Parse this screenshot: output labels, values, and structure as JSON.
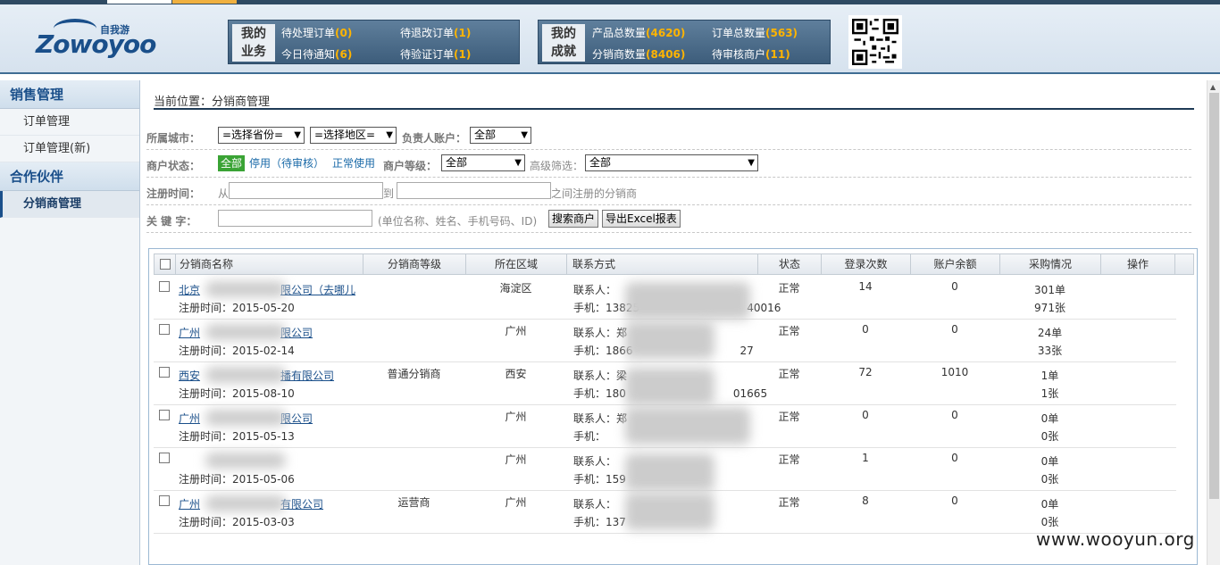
{
  "brand": {
    "logo_cn": "自我游",
    "logo_en": "Zowoyoo"
  },
  "business_panel": {
    "title_line1": "我的",
    "title_line2": "业务",
    "items": [
      {
        "label": "待处理订单",
        "count": "(0)"
      },
      {
        "label": "待退改订单",
        "count": "(1)"
      },
      {
        "label": "今日待通知",
        "count": "(6)"
      },
      {
        "label": "待验证订单",
        "count": "(1)"
      }
    ]
  },
  "achievement_panel": {
    "title_line1": "我的",
    "title_line2": "成就",
    "items": [
      {
        "label": "产品总数量",
        "count": "(4620)"
      },
      {
        "label": "订单总数量",
        "count": "(563)"
      },
      {
        "label": "分销商数量",
        "count": "(8406)"
      },
      {
        "label": "待审核商户",
        "count": "(11)"
      }
    ]
  },
  "sidebar": {
    "groups": [
      {
        "title": "销售管理",
        "items": [
          {
            "label": "订单管理"
          },
          {
            "label": "订单管理(新)"
          }
        ]
      },
      {
        "title": "合作伙伴",
        "items": [
          {
            "label": "分销商管理"
          }
        ]
      }
    ]
  },
  "breadcrumb": "当前位置：分销商管理",
  "filters": {
    "city_label": "所属城市：",
    "province_select": "=选择省份=",
    "region_select": "=选择地区=",
    "owner_label": "负责人账户：",
    "owner_select": "全部",
    "status_label": "商户状态：",
    "status_all": "全部",
    "status_disabled": "停用（待审核）",
    "status_normal": "正常使用",
    "level_label": "商户等级：",
    "level_select": "全部",
    "advanced_label": "高级筛选：",
    "advanced_select": "全部",
    "regtime_label": "注册时间：",
    "from_text": "从",
    "to_text": "到",
    "between_text": "之间注册的分销商",
    "keyword_label": "关 键 字：",
    "keyword_hint": "(单位名称、姓名、手机号码、ID)",
    "search_button": "搜索商户",
    "export_button": "导出Excel报表"
  },
  "table": {
    "columns": [
      "分销商名称",
      "分销商等级",
      "所在区域",
      "联系方式",
      "状态",
      "登录次数",
      "账户余额",
      "采购情况",
      "操作"
    ],
    "rows": [
      {
        "name_a": "北京",
        "name_b": "限公司（去哪儿",
        "regtime": "注册时间：2015-05-20",
        "level": "",
        "region": "海淀区",
        "contact": "联系人：",
        "contact_tail": "",
        "phone": "手机：13825",
        "phone_tail": "40016",
        "status": "正常",
        "logins": "14",
        "balance": "0",
        "orders": "301单",
        "tickets": "971张"
      },
      {
        "name_a": "广州",
        "name_b": "限公司",
        "regtime": "注册时间：2015-02-14",
        "level": "",
        "region": "广州",
        "contact": "联系人：郑",
        "contact_tail": "",
        "phone": "手机：1866",
        "phone_tail": "27",
        "status": "正常",
        "logins": "0",
        "balance": "0",
        "orders": "24单",
        "tickets": "33张"
      },
      {
        "name_a": "西安",
        "name_b": "播有限公司",
        "regtime": "注册时间：2015-08-10",
        "level": "普通分销商",
        "region": "西安",
        "contact": "联系人：梁",
        "contact_tail": "",
        "phone": "手机：180",
        "phone_tail": "01665",
        "status": "正常",
        "logins": "72",
        "balance": "1010",
        "orders": "1单",
        "tickets": "1张"
      },
      {
        "name_a": "广州",
        "name_b": "限公司",
        "regtime": "注册时间：2015-05-13",
        "level": "",
        "region": "广州",
        "contact": "联系人：郑",
        "contact_tail": "",
        "phone": "手机：",
        "phone_tail": "",
        "status": "正常",
        "logins": "0",
        "balance": "0",
        "orders": "0单",
        "tickets": "0张"
      },
      {
        "name_a": "",
        "name_b": "",
        "regtime": "注册时间：2015-05-06",
        "level": "",
        "region": "广州",
        "contact": "联系人：",
        "contact_tail": "",
        "phone": "手机：159",
        "phone_tail": "",
        "status": "正常",
        "logins": "1",
        "balance": "0",
        "orders": "0单",
        "tickets": "0张"
      },
      {
        "name_a": "广州",
        "name_b": "有限公司",
        "regtime": "注册时间：2015-03-03",
        "level": "运营商",
        "region": "广州",
        "contact": "联系人：",
        "contact_tail": "",
        "phone": "手机：137",
        "phone_tail": "",
        "status": "正常",
        "logins": "8",
        "balance": "0",
        "orders": "0单",
        "tickets": "0张"
      }
    ]
  },
  "watermark": "www.wooyun.org"
}
